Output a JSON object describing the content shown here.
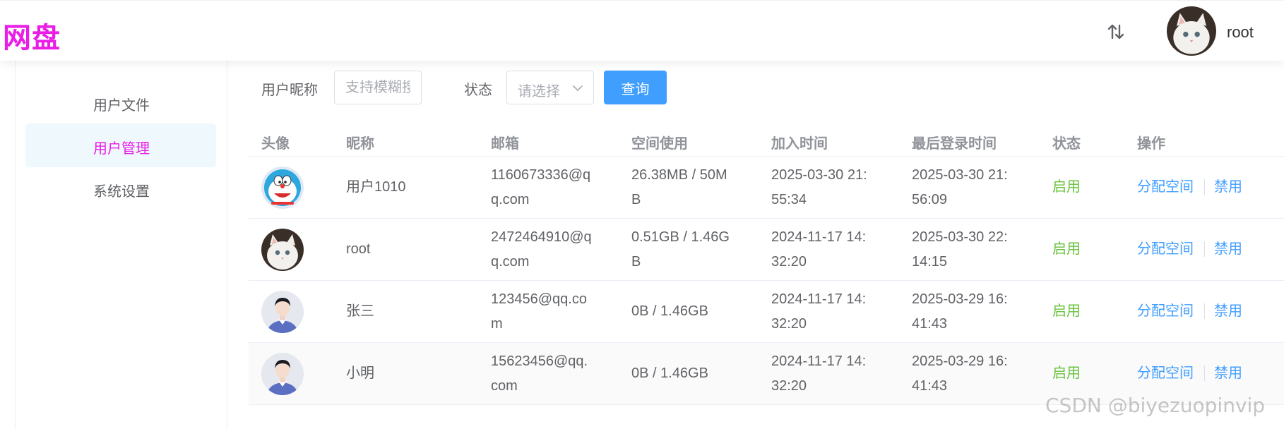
{
  "header": {
    "logo": "网盘",
    "transfer_icon": "sort-arrows-icon",
    "username": "root"
  },
  "sidebar": {
    "items": [
      {
        "label": "用户文件",
        "active": false
      },
      {
        "label": "用户管理",
        "active": true
      },
      {
        "label": "系统设置",
        "active": false
      }
    ]
  },
  "filters": {
    "nickname_label": "用户昵称",
    "nickname_placeholder": "支持模糊搜",
    "status_label": "状态",
    "status_placeholder": "请选择",
    "query_label": "查询"
  },
  "table": {
    "columns": [
      "头像",
      "昵称",
      "邮箱",
      "空间使用",
      "加入时间",
      "最后登录时间",
      "状态",
      "操作"
    ],
    "rows": [
      {
        "avatar": "doraemon-avatar",
        "nickname": "用户1010",
        "email": [
          "1160673336@q",
          "q.com"
        ],
        "space": [
          "26.38MB / 50M",
          "B"
        ],
        "join_time": [
          "2025-03-30 21:",
          "55:34"
        ],
        "last_login": [
          "2025-03-30 21:",
          "56:09"
        ],
        "status": "启用",
        "action_allocate": "分配空间",
        "action_disable": "禁用"
      },
      {
        "avatar": "cat-avatar",
        "nickname": "root",
        "email": [
          "2472464910@q",
          "q.com"
        ],
        "space": [
          "0.51GB / 1.46G",
          "B"
        ],
        "join_time": [
          "2024-11-17 14:",
          "32:20"
        ],
        "last_login": [
          "2025-03-30 22:",
          "14:15"
        ],
        "status": "启用",
        "action_allocate": "分配空间",
        "action_disable": "禁用"
      },
      {
        "avatar": "default-person-avatar",
        "nickname": "张三",
        "email": [
          "123456@qq.co",
          "m"
        ],
        "space": [
          "0B / 1.46GB"
        ],
        "join_time": [
          "2024-11-17 14:",
          "32:20"
        ],
        "last_login": [
          "2025-03-29 16:",
          "41:43"
        ],
        "status": "启用",
        "action_allocate": "分配空间",
        "action_disable": "禁用"
      },
      {
        "avatar": "default-person-avatar",
        "nickname": "小明",
        "email": [
          "15623456@qq.",
          "com"
        ],
        "space": [
          "0B / 1.46GB"
        ],
        "join_time": [
          "2024-11-17 14:",
          "32:20"
        ],
        "last_login": [
          "2025-03-29 16:",
          "41:43"
        ],
        "status": "启用",
        "action_allocate": "分配空间",
        "action_disable": "禁用"
      }
    ]
  },
  "watermark": "CSDN @biyezuopinvip",
  "colors": {
    "logo": "#e91de6",
    "primary": "#409eff",
    "success": "#67c23a",
    "active_menu_bg": "#eef8fd"
  }
}
